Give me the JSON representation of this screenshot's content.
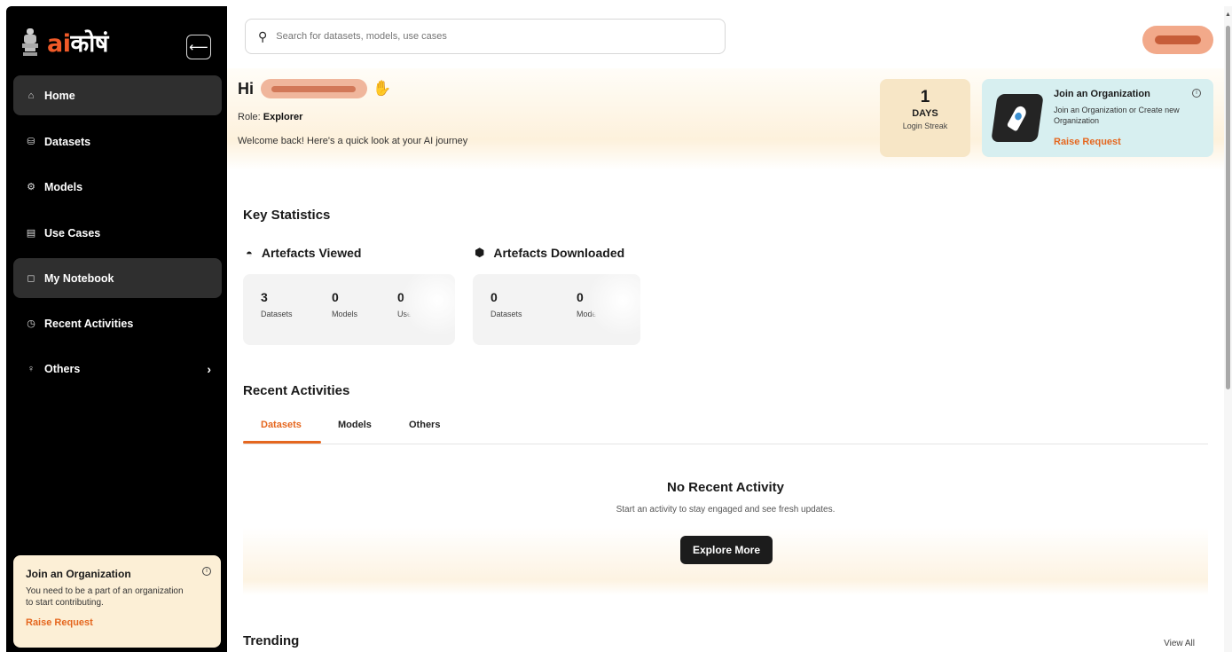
{
  "brand": {
    "prefix": "ai",
    "suffix": "कोषं"
  },
  "sidebar": {
    "collapse_icon": "⟵",
    "items": [
      {
        "label": "Home",
        "icon": "⌂"
      },
      {
        "label": "Datasets",
        "icon": "⛁"
      },
      {
        "label": "Models",
        "icon": "⚙"
      },
      {
        "label": "Use Cases",
        "icon": "▤"
      },
      {
        "label": "My Notebook",
        "icon": "◻"
      },
      {
        "label": "Recent Activities",
        "icon": "◷"
      },
      {
        "label": "Others",
        "icon": "♀",
        "chevron": "›"
      }
    ],
    "card": {
      "title": "Join an Organization",
      "description": "You need to be a part of an organization to start contributing.",
      "action": "Raise Request",
      "info_icon": "i"
    }
  },
  "search": {
    "placeholder": "Search for datasets, models, use cases",
    "icon": "⚲"
  },
  "hero": {
    "greeting": "Hi",
    "wave": "✋",
    "role_label": "Role:",
    "role_value": "Explorer",
    "welcome": "Welcome back! Here's a quick look at your AI journey",
    "streak": {
      "value": "1",
      "unit": "DAYS",
      "label": "Login Streak"
    },
    "org_card": {
      "title": "Join an Organization",
      "description": "Join an Organization or Create new Organization",
      "action": "Raise Request",
      "info_icon": "i"
    }
  },
  "key_statistics": {
    "title": "Key Statistics",
    "viewed": {
      "title": "Artefacts Viewed",
      "icon": "◓",
      "stats": [
        {
          "value": "3",
          "label": "Datasets"
        },
        {
          "value": "0",
          "label": "Models"
        },
        {
          "value": "0",
          "label": "Usecases"
        }
      ]
    },
    "downloaded": {
      "title": "Artefacts Downloaded",
      "icon": "⬢",
      "stats": [
        {
          "value": "0",
          "label": "Datasets"
        },
        {
          "value": "0",
          "label": "Models"
        }
      ]
    }
  },
  "recent_activities": {
    "title": "Recent Activities",
    "tabs": [
      "Datasets",
      "Models",
      "Others"
    ],
    "empty_title": "No Recent Activity",
    "empty_desc": "Start an activity to stay engaged and see fresh updates.",
    "cta": "Explore More"
  },
  "trending": {
    "title": "Trending",
    "view_all": "View All"
  },
  "colors": {
    "accent": "#e5671f",
    "sidebar_bg": "#000000",
    "active_nav": "#2f2f2f"
  }
}
